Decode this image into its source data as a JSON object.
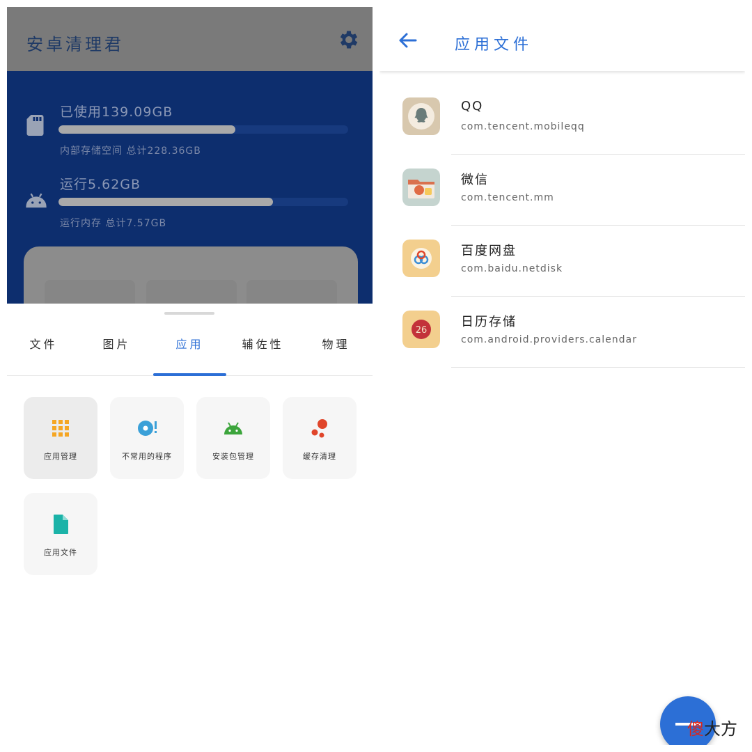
{
  "left": {
    "app_title": "安卓清理君",
    "storage": {
      "used_label": "已使用139.09GB",
      "used_fraction": 0.61,
      "storage_sub": "内部存储空间 总计228.36GB"
    },
    "memory": {
      "run_label": "运行5.62GB",
      "run_fraction": 0.74,
      "memory_sub": "运行内存 总计7.57GB"
    },
    "tabs": [
      {
        "label": "文件",
        "active": false
      },
      {
        "label": "图片",
        "active": false
      },
      {
        "label": "应用",
        "active": true
      },
      {
        "label": "辅佐性",
        "active": false
      },
      {
        "label": "物理",
        "active": false
      }
    ],
    "tiles": [
      {
        "label": "应用管理",
        "icon": "grid-icon",
        "color": "#f5a623"
      },
      {
        "label": "不常用的程序",
        "icon": "disc-alert-icon",
        "color": "#3aa0d8"
      },
      {
        "label": "安装包管理",
        "icon": "android-icon",
        "color": "#3ca53c"
      },
      {
        "label": "缓存清理",
        "icon": "bubbles-icon",
        "color": "#e0452a"
      },
      {
        "label": "应用文件",
        "icon": "file-icon",
        "color": "#1bb3a8"
      }
    ]
  },
  "right": {
    "title": "应用文件",
    "apps": [
      {
        "name": "QQ",
        "package": "com.tencent.mobileqq",
        "icon": "qq-icon"
      },
      {
        "name": "微信",
        "package": "com.tencent.mm",
        "icon": "folder-icon"
      },
      {
        "name": "百度网盘",
        "package": "com.baidu.netdisk",
        "icon": "netdisk-icon"
      },
      {
        "name": "日历存储",
        "package": "com.android.providers.calendar",
        "icon": "calendar-icon",
        "badge": "26"
      }
    ]
  },
  "watermark": {
    "red_char": "傻",
    "rest": "大方"
  },
  "colors": {
    "accent": "#2c6fd6",
    "panel": "#0d2e6e"
  }
}
